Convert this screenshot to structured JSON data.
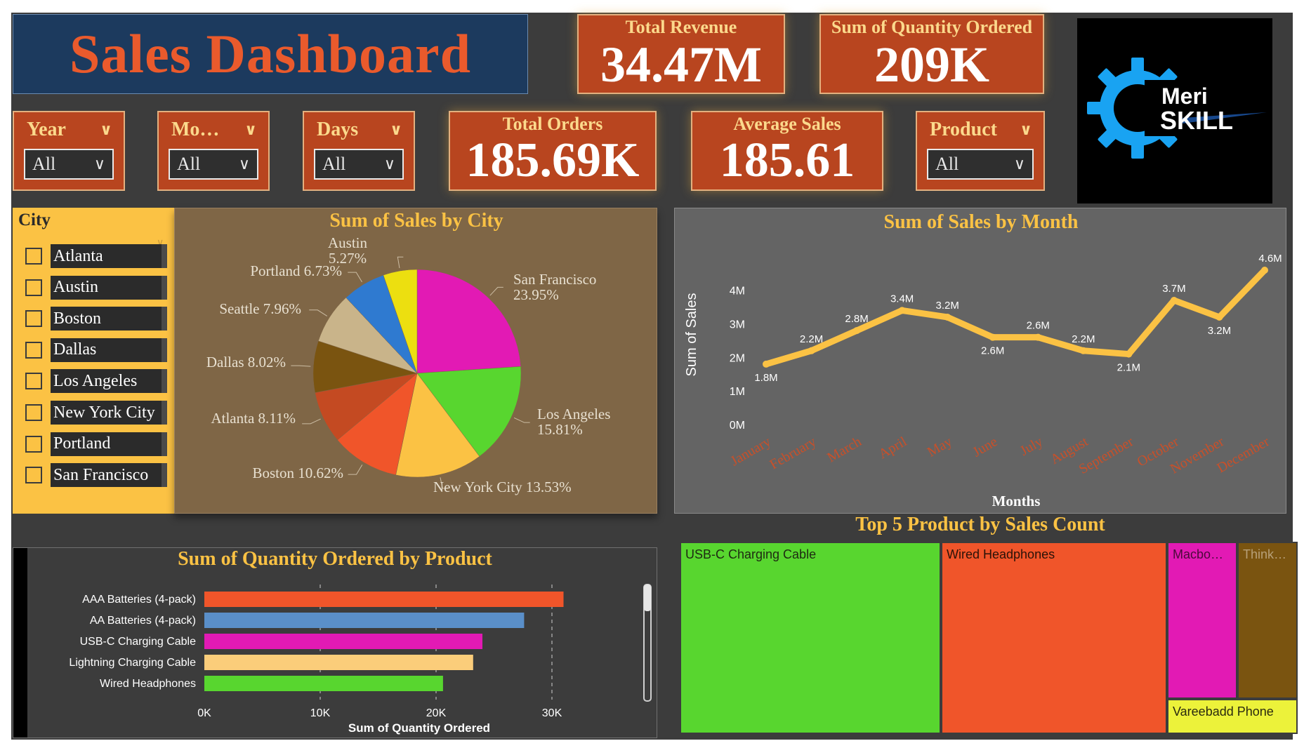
{
  "header": {
    "title": "Sales Dashboard"
  },
  "kpis": {
    "total_revenue": {
      "label": "Total Revenue",
      "value": "34.47M"
    },
    "quantity_ordered": {
      "label": "Sum of Quantity Ordered",
      "value": "209K"
    },
    "total_orders": {
      "label": "Total Orders",
      "value": "185.69K"
    },
    "average_sales": {
      "label": "Average Sales",
      "value": "185.61"
    }
  },
  "filters": {
    "year": {
      "label": "Year",
      "value": "All"
    },
    "month": {
      "label": "Mo…",
      "value": "All"
    },
    "days": {
      "label": "Days",
      "value": "All"
    },
    "product": {
      "label": "Product",
      "value": "All"
    }
  },
  "logo": {
    "line1": "Meri",
    "line2": "SKILL"
  },
  "city_slicer": {
    "title": "City",
    "items": [
      "Atlanta",
      "Austin",
      "Boston",
      "Dallas",
      "Los Angeles",
      "New York City",
      "Portland",
      "San Francisco"
    ]
  },
  "colors": {
    "accent": "#fbc244",
    "kpi_bg": "#b8451f",
    "title_bg": "#1c3a5e",
    "title_text": "#ea5a2c",
    "line": "#fbc244",
    "month_label": "#c8502a"
  },
  "chart_data": [
    {
      "type": "pie",
      "title": "Sum of Sales by City",
      "slices": [
        {
          "label": "San Francisco",
          "percent": 23.95,
          "display": "23.95%",
          "color": "#e21ab4"
        },
        {
          "label": "Los Angeles",
          "percent": 15.81,
          "display": "15.81%",
          "color": "#58d62f"
        },
        {
          "label": "New York City",
          "percent": 13.53,
          "display": "13.53%",
          "color": "#fbc244"
        },
        {
          "label": "Boston",
          "percent": 10.62,
          "display": "10.62%",
          "color": "#f0552a"
        },
        {
          "label": "Atlanta",
          "percent": 8.11,
          "display": "8.11%",
          "color": "#c44a22"
        },
        {
          "label": "Dallas",
          "percent": 8.02,
          "display": "8.02%",
          "color": "#7a5410"
        },
        {
          "label": "Seattle",
          "percent": 7.96,
          "display": "7.96%",
          "color": "#c9b48a"
        },
        {
          "label": "Portland",
          "percent": 6.73,
          "display": "6.73%",
          "color": "#2f7ad0"
        },
        {
          "label": "Austin",
          "percent": 5.27,
          "display": "5.27%",
          "color": "#ecdf10"
        }
      ]
    },
    {
      "type": "line",
      "title": "Sum of Sales by Month",
      "xlabel": "Months",
      "ylabel": "Sum of Sales",
      "ylim": [
        0,
        4.6
      ],
      "yticks": [
        "0M",
        "1M",
        "2M",
        "3M",
        "4M"
      ],
      "categories": [
        "January",
        "February",
        "March",
        "April",
        "May",
        "June",
        "July",
        "August",
        "September",
        "October",
        "November",
        "December"
      ],
      "values": [
        1.8,
        2.2,
        2.8,
        3.4,
        3.2,
        2.6,
        2.6,
        2.2,
        2.1,
        3.7,
        3.2,
        4.6
      ],
      "data_labels": [
        "1.8M",
        "2.2M",
        "2.8M",
        "3.4M",
        "3.2M",
        "2.6M",
        "2.6M",
        "2.2M",
        "2.1M",
        "3.7M",
        "3.2M",
        "4.6M"
      ]
    },
    {
      "type": "bar",
      "orientation": "horizontal",
      "title": "Sum of Quantity Ordered by Product",
      "xlabel": "Sum of Quantity Ordered",
      "xlim": [
        0,
        32000
      ],
      "xticks": [
        "0K",
        "10K",
        "20K",
        "30K"
      ],
      "categories": [
        "AAA Batteries (4-pack)",
        "AA Batteries (4-pack)",
        "USB-C Charging Cable",
        "Lightning Charging Cable",
        "Wired Headphones"
      ],
      "values": [
        31000,
        27600,
        24000,
        23200,
        20600
      ],
      "colors": [
        "#f0552a",
        "#5a8fc9",
        "#e21ab4",
        "#fbcd7a",
        "#58d62f"
      ]
    },
    {
      "type": "treemap",
      "title": "Top 5 Product by Sales Count",
      "items": [
        {
          "label": "USB-C Charging Cable",
          "color": "#58d62f"
        },
        {
          "label": "Wired Headphones",
          "color": "#f0552a"
        },
        {
          "label": "Macbo…",
          "color": "#e21ab4"
        },
        {
          "label": "Think…",
          "color": "#7a5410"
        },
        {
          "label": "Vareebadd Phone",
          "color": "#ecf23a"
        }
      ]
    }
  ]
}
